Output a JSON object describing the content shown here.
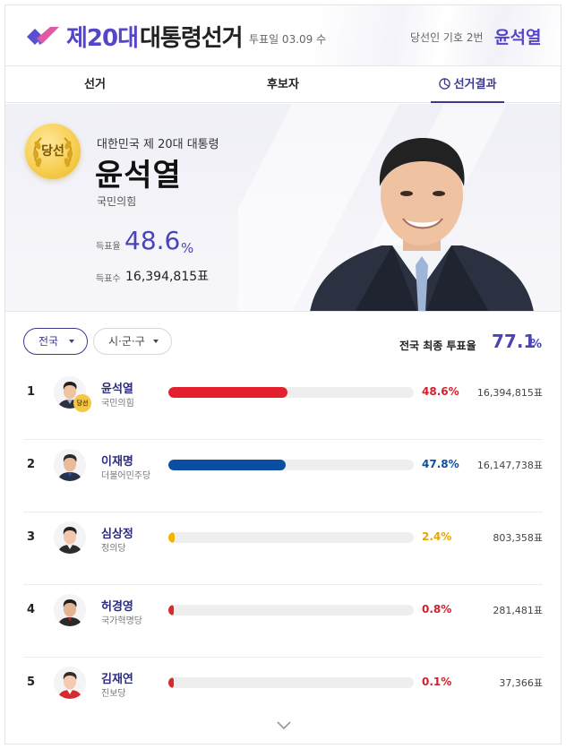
{
  "header": {
    "title_strong": "제20대",
    "title_rest": "대통령선거",
    "vote_date": "투표일 03.09 수",
    "winner_label": "당선인 기호 2번",
    "winner_name": "윤석열"
  },
  "tabs": [
    {
      "label": "선거"
    },
    {
      "label": "후보자"
    },
    {
      "label": "선거결과",
      "icon": "pie-chart-icon",
      "active": true
    }
  ],
  "hero": {
    "badge": "당선",
    "subtitle": "대한민국 제 20대 대통령",
    "name": "윤석열",
    "party": "국민의힘",
    "rate_label": "득표율",
    "rate_value": "48.6",
    "rate_unit": "%",
    "count_label": "득표수",
    "count_value": "16,394,815표"
  },
  "filters": {
    "region": "전국",
    "district": "시·군·구",
    "turnout_label": "전국 최종 투표율",
    "turnout_value": "77.1",
    "turnout_unit": "%"
  },
  "colors": {
    "accent": "#4a44b8",
    "people_power": "#e4202e",
    "democratic": "#0a4ea2",
    "justice": "#f2b400",
    "minor_red": "#d72a2f"
  },
  "results": [
    {
      "rank": "1",
      "name": "윤석열",
      "party": "국민의힘",
      "percent": "48.6%",
      "share": 48.6,
      "votes": "16,394,815표",
      "color": "#e4202e",
      "pct_color": "#d3202b",
      "winner": true,
      "winner_badge": "당선"
    },
    {
      "rank": "2",
      "name": "이재명",
      "party": "더불어민주당",
      "percent": "47.8%",
      "share": 47.8,
      "votes": "16,147,738표",
      "color": "#0a4ea2",
      "pct_color": "#0a4ea2",
      "winner": false
    },
    {
      "rank": "3",
      "name": "심상정",
      "party": "정의당",
      "percent": "2.4%",
      "share": 2.4,
      "votes": "803,358표",
      "color": "#f2b400",
      "pct_color": "#e8a500",
      "winner": false
    },
    {
      "rank": "4",
      "name": "허경영",
      "party": "국가혁명당",
      "percent": "0.8%",
      "share": 0.8,
      "votes": "281,481표",
      "color": "#d72a2f",
      "pct_color": "#d3202b",
      "winner": false
    },
    {
      "rank": "5",
      "name": "김재연",
      "party": "진보당",
      "percent": "0.1%",
      "share": 0.1,
      "votes": "37,366표",
      "color": "#d72a2f",
      "pct_color": "#d3202b",
      "winner": false
    }
  ]
}
